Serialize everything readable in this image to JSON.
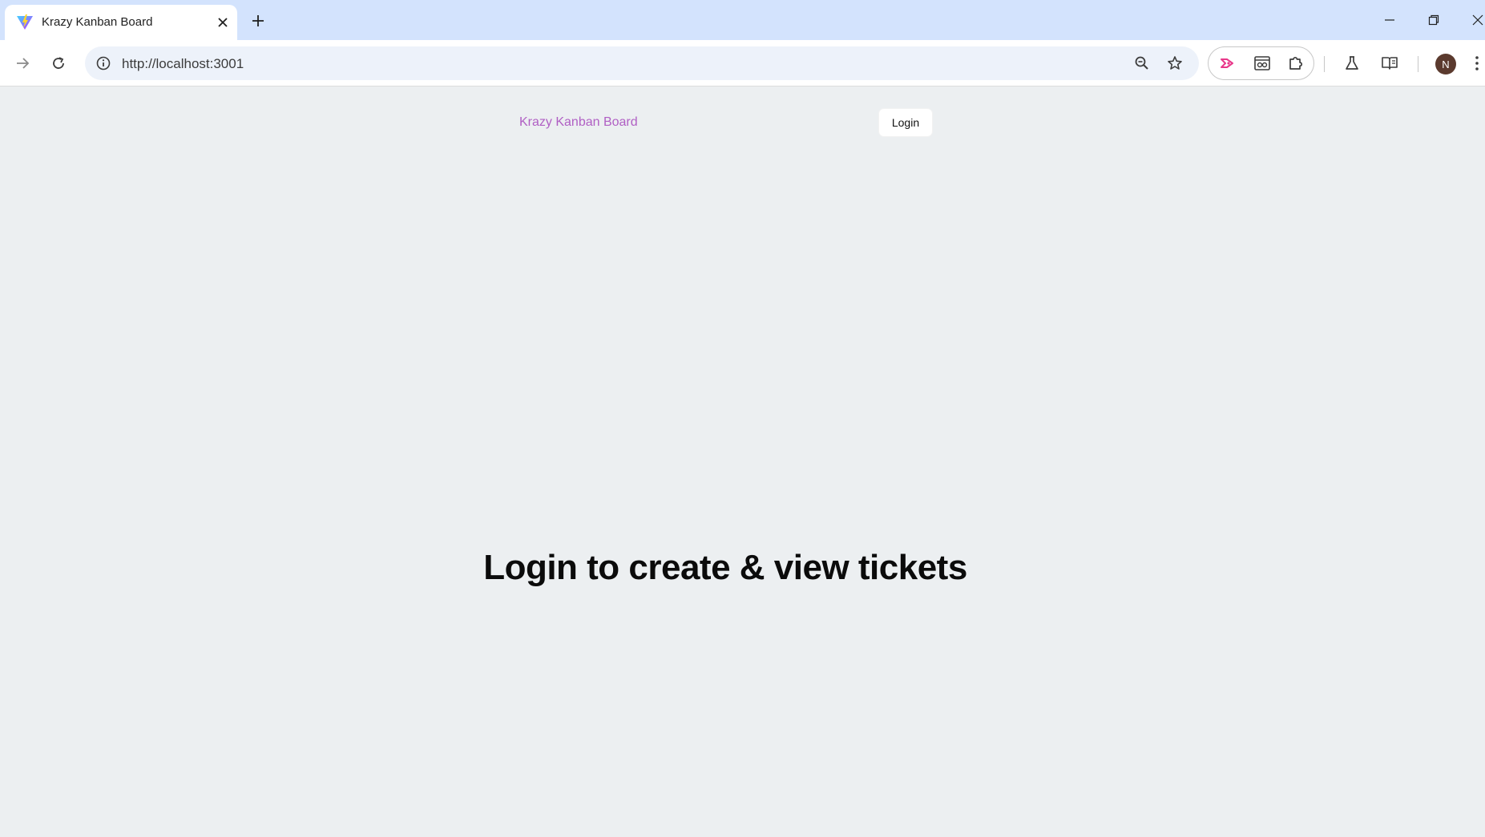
{
  "browser": {
    "tab": {
      "title": "Krazy Kanban Board",
      "favicon": "vite-logo-icon"
    },
    "new_tab_icon": "plus-icon",
    "window_controls": [
      "minimize-icon",
      "restore-icon",
      "close-icon"
    ],
    "address_bar": {
      "url": "http://localhost:3001"
    },
    "toolbar_icons": [
      "back-icon",
      "reload-icon",
      "site-info-icon",
      "zoom-icon",
      "bookmark-star-icon",
      "extension-arrow-icon",
      "extension-reader-icon",
      "extensions-puzzle-icon",
      "labs-flask-icon",
      "reading-mode-icon",
      "menu-kebab-icon"
    ],
    "profile": {
      "initial": "N",
      "color": "#5b3a2e"
    }
  },
  "page": {
    "nav": {
      "brand": "Krazy Kanban Board",
      "login_label": "Login"
    },
    "hero_text": "Login to create & view tickets"
  },
  "colors": {
    "page_background": "#eceff1",
    "brand": "#b05fc4",
    "tabstrip": "#d3e3fd"
  }
}
